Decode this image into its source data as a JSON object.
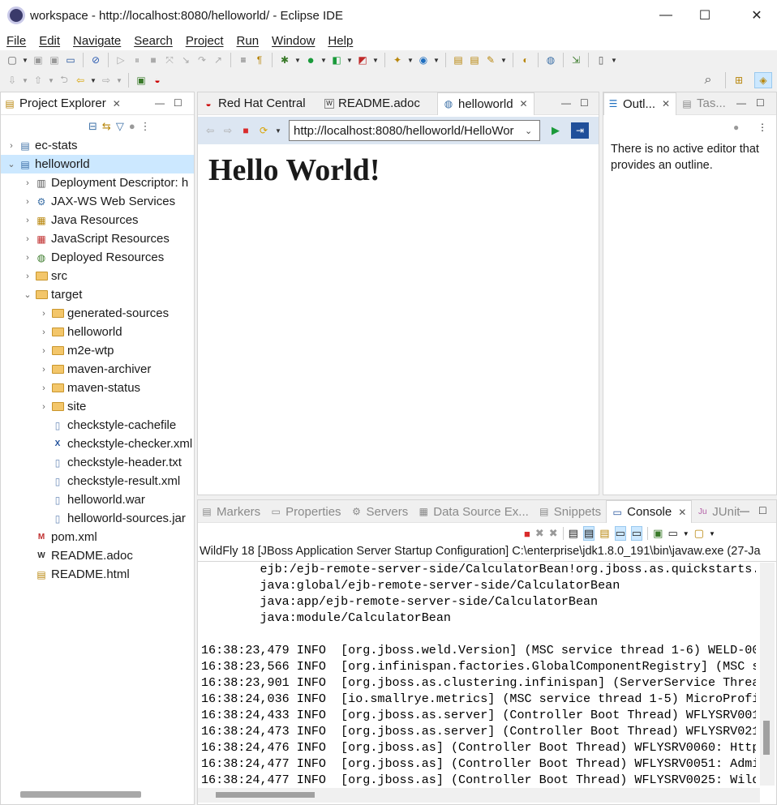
{
  "window": {
    "title": "workspace - http://localhost:8080/helloworld/ - Eclipse IDE",
    "minimize": "—",
    "maximize": "☐",
    "close": "✕"
  },
  "menu": [
    "File",
    "Edit",
    "Navigate",
    "Search",
    "Project",
    "Run",
    "Window",
    "Help"
  ],
  "project_explorer": {
    "tab": "Project Explorer",
    "tree": [
      {
        "label": "ec-stats",
        "depth": 0,
        "chevron": "›",
        "icon": "project-icon"
      },
      {
        "label": "helloworld",
        "depth": 0,
        "chevron": "⌄",
        "icon": "project-icon",
        "selected": true
      },
      {
        "label": "Deployment Descriptor: h",
        "depth": 1,
        "chevron": "›",
        "icon": "descriptor-icon"
      },
      {
        "label": "JAX-WS Web Services",
        "depth": 1,
        "chevron": "›",
        "icon": "webservice-icon"
      },
      {
        "label": "Java Resources",
        "depth": 1,
        "chevron": "›",
        "icon": "java-resources-icon"
      },
      {
        "label": "JavaScript Resources",
        "depth": 1,
        "chevron": "›",
        "icon": "javascript-resources-icon"
      },
      {
        "label": "Deployed Resources",
        "depth": 1,
        "chevron": "›",
        "icon": "deployed-resources-icon"
      },
      {
        "label": "src",
        "depth": 1,
        "chevron": "›",
        "icon": "folder-icon"
      },
      {
        "label": "target",
        "depth": 1,
        "chevron": "⌄",
        "icon": "folder-icon"
      },
      {
        "label": "generated-sources",
        "depth": 2,
        "chevron": "›",
        "icon": "folder-icon"
      },
      {
        "label": "helloworld",
        "depth": 2,
        "chevron": "›",
        "icon": "folder-icon"
      },
      {
        "label": "m2e-wtp",
        "depth": 2,
        "chevron": "›",
        "icon": "folder-icon"
      },
      {
        "label": "maven-archiver",
        "depth": 2,
        "chevron": "›",
        "icon": "folder-icon"
      },
      {
        "label": "maven-status",
        "depth": 2,
        "chevron": "›",
        "icon": "folder-icon"
      },
      {
        "label": "site",
        "depth": 2,
        "chevron": "›",
        "icon": "folder-icon"
      },
      {
        "label": "checkstyle-cachefile",
        "depth": 2,
        "chevron": "",
        "icon": "file-icon"
      },
      {
        "label": "checkstyle-checker.xml",
        "depth": 2,
        "chevron": "",
        "icon": "xml-file-icon"
      },
      {
        "label": "checkstyle-header.txt",
        "depth": 2,
        "chevron": "",
        "icon": "file-icon"
      },
      {
        "label": "checkstyle-result.xml",
        "depth": 2,
        "chevron": "",
        "icon": "file-icon"
      },
      {
        "label": "helloworld.war",
        "depth": 2,
        "chevron": "",
        "icon": "file-icon"
      },
      {
        "label": "helloworld-sources.jar",
        "depth": 2,
        "chevron": "",
        "icon": "file-icon"
      },
      {
        "label": "pom.xml",
        "depth": 1,
        "chevron": "",
        "icon": "maven-pom-icon"
      },
      {
        "label": "README.adoc",
        "depth": 1,
        "chevron": "",
        "icon": "adoc-file-icon"
      },
      {
        "label": "README.html",
        "depth": 1,
        "chevron": "",
        "icon": "html-file-icon"
      }
    ]
  },
  "editor": {
    "tabs": [
      {
        "label": "Red Hat Central",
        "icon": "redhat-icon",
        "active": false
      },
      {
        "label": "README.adoc",
        "icon": "adoc-file-icon",
        "active": false
      },
      {
        "label": "helloworld",
        "icon": "globe-icon",
        "active": true
      }
    ],
    "url": "http://localhost:8080/helloworld/HelloWor",
    "page_heading": "Hello World!"
  },
  "outline": {
    "tabs": [
      {
        "label": "Outl...",
        "active": true
      },
      {
        "label": "Tas...",
        "active": false
      }
    ],
    "message": "There is no active editor that provides an outline."
  },
  "bottom": {
    "tabs": [
      {
        "label": "Markers",
        "active": false
      },
      {
        "label": "Properties",
        "active": false
      },
      {
        "label": "Servers",
        "active": false
      },
      {
        "label": "Data Source Ex...",
        "active": false
      },
      {
        "label": "Snippets",
        "active": false
      },
      {
        "label": "Console",
        "active": true
      },
      {
        "label": "JUnit",
        "active": false
      }
    ],
    "console_header": "WildFly 18 [JBoss Application Server Startup Configuration] C:\\enterprise\\jdk1.8.0_191\\bin\\javaw.exe  (27-Ja",
    "console_lines": [
      "        ejb:/ejb-remote-server-side/CalculatorBean!org.jboss.as.quickstarts.",
      "        java:global/ejb-remote-server-side/CalculatorBean",
      "        java:app/ejb-remote-server-side/CalculatorBean",
      "        java:module/CalculatorBean",
      "",
      "16:38:23,479 INFO  [org.jboss.weld.Version] (MSC service thread 1-6) WELD-000",
      "16:38:23,566 INFO  [org.infinispan.factories.GlobalComponentRegistry] (MSC s",
      "16:38:23,901 INFO  [org.jboss.as.clustering.infinispan] (ServerService Threa",
      "16:38:24,036 INFO  [io.smallrye.metrics] (MSC service thread 1-5) MicroProfi",
      "16:38:24,433 INFO  [org.jboss.as.server] (Controller Boot Thread) WFLYSRV001",
      "16:38:24,473 INFO  [org.jboss.as.server] (Controller Boot Thread) WFLYSRV021",
      "16:38:24,476 INFO  [org.jboss.as] (Controller Boot Thread) WFLYSRV0060: Http",
      "16:38:24,477 INFO  [org.jboss.as] (Controller Boot Thread) WFLYSRV0051: Admi",
      "16:38:24,477 INFO  [org.jboss.as] (Controller Boot Thread) WFLYSRV0025: Wild"
    ]
  },
  "colors": {
    "selection": "#cce8ff",
    "accent": "#0078d7",
    "run_green": "#1a9a3a",
    "stop_red": "#d92b2b"
  }
}
